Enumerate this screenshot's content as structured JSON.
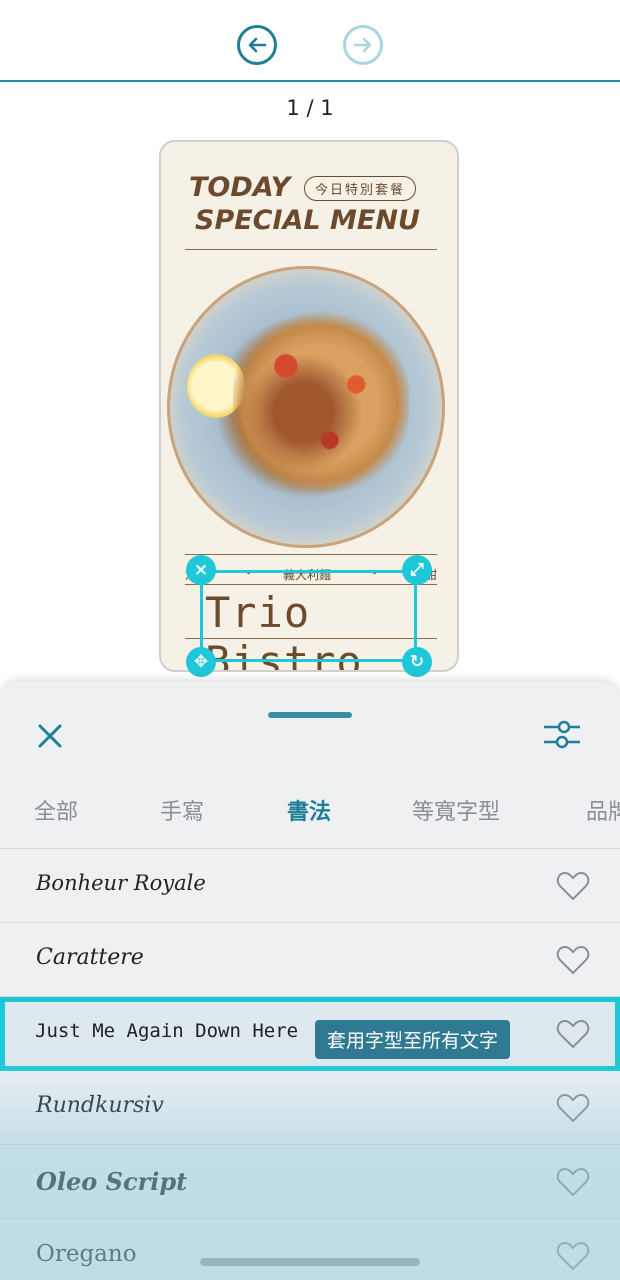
{
  "toolbar": {
    "undo_icon": "undo-icon",
    "redo_icon": "redo-icon",
    "accent": "#1f7f97"
  },
  "page_counter": "1 / 1",
  "card": {
    "title_line1": "TODAY",
    "title_line2": "SPECIAL MENU",
    "pill": "今日特別套餐",
    "sub_left": "湯",
    "sub_bullet1": "•",
    "sub_middle": "義大利麵",
    "sub_bullet2": "•",
    "sub_right": "甜",
    "handwritten_text": "Trio Bistro"
  },
  "selection_handles": {
    "close": "×",
    "resize": "⤢",
    "move": "✥",
    "rotate": "↻"
  },
  "sheet": {
    "tabs": [
      "全部",
      "手寫",
      "書法",
      "等寬字型",
      "品牌"
    ],
    "active_tab": "書法",
    "fonts": [
      {
        "name": "Bonheur Royale"
      },
      {
        "name": "Carattere"
      },
      {
        "name": "Just Me Again Down Here",
        "selected": true
      },
      {
        "name": "Rundkursiv"
      },
      {
        "name": "Oleo Script"
      },
      {
        "name": "Oregano"
      }
    ],
    "apply_all_label": "套用字型至所有文字",
    "highlight_color": "#1fc8d8"
  }
}
